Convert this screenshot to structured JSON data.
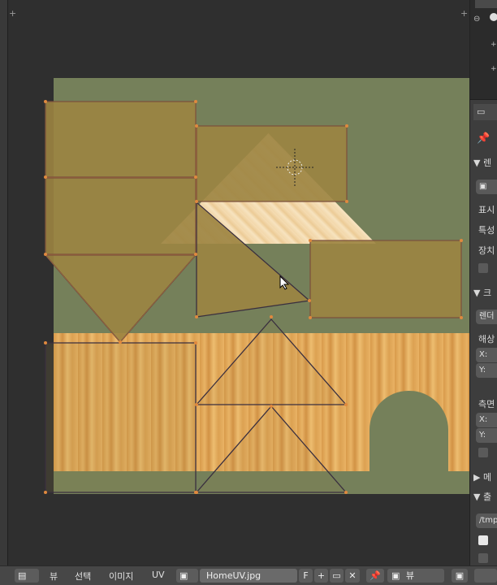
{
  "footer": {
    "menu_view": "뷰",
    "menu_select": "선택",
    "menu_image": "이미지",
    "menu_uv": "UV",
    "image_name": "HomeUV.jpg",
    "fake_user": "F",
    "view_mode": "뷰"
  },
  "properties": {
    "render_section": "▼ 렌",
    "display_label": "표시",
    "feature_label": "특성",
    "device_label": "장치",
    "section_2": "▼ 크",
    "render_field": "렌더",
    "resolution_label": "해상",
    "x_label": "X:",
    "y_label": "Y:",
    "aspect_label": "측면",
    "section_meta": "▶ 메",
    "section_output": "▼ 출",
    "output_path": "/tmp"
  },
  "colors": {
    "uv_edge": "#d9823a",
    "face_fill": "#9c8441",
    "background_green": "#75805a"
  }
}
